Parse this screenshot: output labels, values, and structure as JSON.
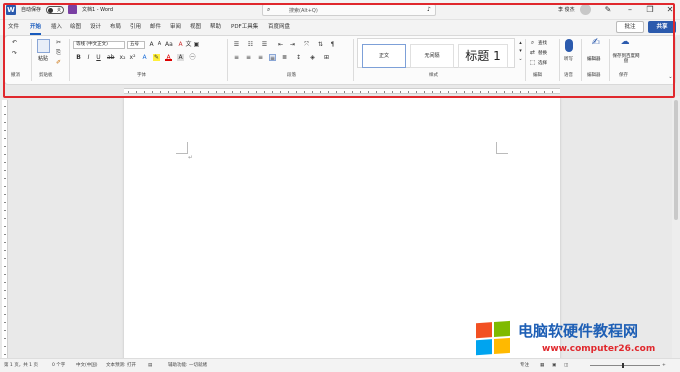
{
  "titlebar": {
    "autosave_label": "自动保存",
    "autosave_state": "关",
    "doc_title": "文档1 - Word",
    "search_placeholder": "搜索(Alt+Q)",
    "user_name": "李 俊杰"
  },
  "tabs": [
    "文件",
    "开始",
    "插入",
    "绘图",
    "设计",
    "布局",
    "引用",
    "邮件",
    "审阅",
    "视图",
    "帮助",
    "PDF工具集",
    "百度网盘"
  ],
  "active_tab": "开始",
  "actions": {
    "note": "批注",
    "share": "共享"
  },
  "ribbon": {
    "paste": "粘贴",
    "font_name": "等线 (中文正文)",
    "font_size": "五号",
    "styles": {
      "normal": "正文",
      "no_spacing": "无间隔",
      "heading1": "标题 1"
    },
    "find": "查找",
    "replace": "替换",
    "select": "选择",
    "dictate": "听写",
    "editor": "编辑器",
    "save_to_baidu": "保存到百度网盘",
    "groups": {
      "undo": "撤消",
      "clipboard": "剪贴板",
      "font": "字体",
      "paragraph": "段落",
      "styles": "样式",
      "editing": "编辑",
      "voice": "语音",
      "editor": "编辑器",
      "save": "保存"
    }
  },
  "statusbar": {
    "page": "第 1 页，共 1 页",
    "words": "0 个字",
    "language": "中文(中国)",
    "predict": "文本预测: 打开",
    "accessibility": "辅助功能: 一切就绪",
    "focus": "专注"
  },
  "watermark": {
    "title": "电脑软硬件教程网",
    "url": "www.computer26.com"
  },
  "colors": {
    "brand": "#2b5aad",
    "highlight": "#e0282d",
    "watermark_text": "#1e5fb5"
  }
}
